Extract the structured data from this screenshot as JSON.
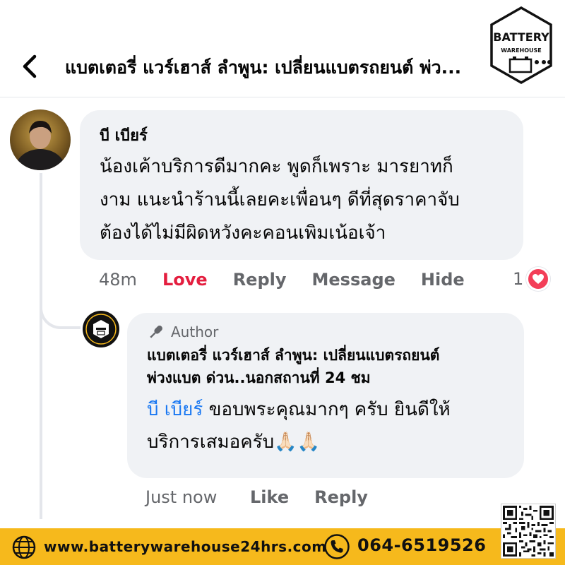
{
  "header": {
    "title": "แบตเตอรี่ แวร์เฮาส์ ลำพูน: เปลี่ยนแบตรถยนต์ พ่ว...",
    "logo_text_top": "BATTERY",
    "logo_text_bottom": "WAREHOUSE"
  },
  "comment": {
    "author": "บี เบียร์",
    "lines": [
      "น้องเค้าบริการดีมากคะ พูดก็เพราะ มารยาทก็",
      "งาม แนะนำร้านนี้เลยคะเพื่อนๆ ดีที่สุดราคาจับ",
      "ต้องได้ไม่มีผิดหวังคะคอนเพิมเน้อเจ้า"
    ],
    "time": "48m",
    "love_label": "Love",
    "reply_label": "Reply",
    "message_label": "Message",
    "hide_label": "Hide",
    "reaction_count": "1"
  },
  "reply": {
    "badge": "Author",
    "page_name_line1": "แบตเตอรี่ แวร์เฮาส์ ลำพูน: เปลี่ยนแบตรถยนต์",
    "page_name_line2": "พ่วงแบต ด่วน..นอกสถานที่ 24 ชม",
    "mention": "บี เบียร์",
    "text_line1": " ขอบพระคุณมากๆ ครับ ยินดีให้",
    "text_line2": "บริการเสมอครับ",
    "emoji": "🙏🏻🙏🏻",
    "time": "Just now",
    "like_label": "Like",
    "reply_label": "Reply"
  },
  "footer": {
    "website": "www.batterywarehouse24hrs.com",
    "phone": "064-6519526"
  },
  "colors": {
    "accent_blue": "#1877f2",
    "love_red": "#e41e3f",
    "bubble_bg": "#f0f2f5",
    "footer_yellow": "#f6b91c"
  }
}
